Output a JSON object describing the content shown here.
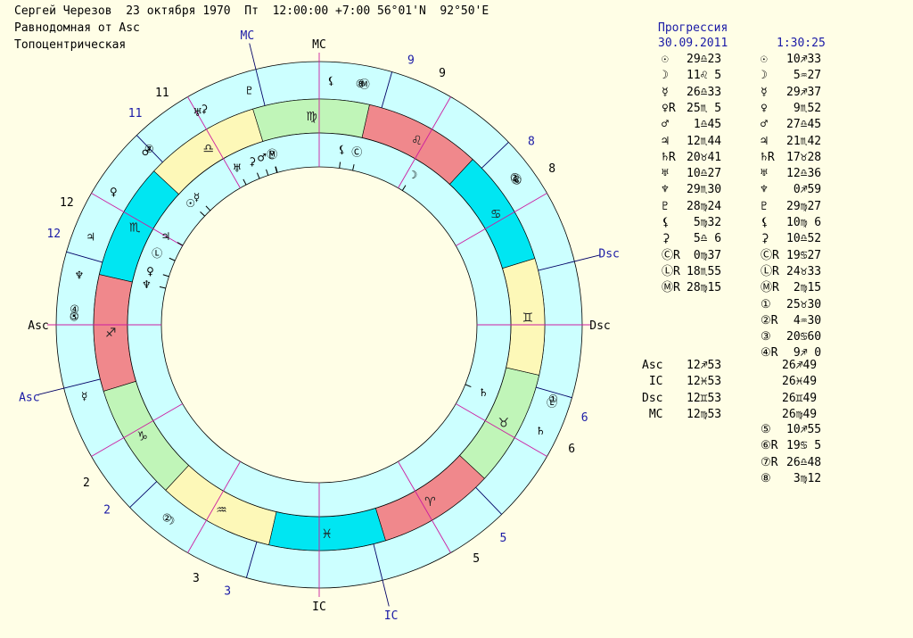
{
  "header": {
    "line1": "Сергей Черезов  23 октября 1970  Пт  12:00:00 +7:00 56°01'N  92°50'E",
    "line2": "Равнодомная от Asc",
    "line3": "Топоцентрическая"
  },
  "chart": {
    "outer_ring_color": "#ccffff",
    "zodiac_colors": {
      "fire": "#f0888c",
      "earth": "#c0f5b8",
      "air": "#fdf8b8",
      "water": "#00e6f2"
    },
    "signs": [
      "♈",
      "♉",
      "♊",
      "♋",
      "♌",
      "♍",
      "♎",
      "♏",
      "♐",
      "♑",
      "♒",
      "♓"
    ],
    "natal_house_labels": [
      "Asc",
      "2",
      "3",
      "IC",
      "5",
      "6",
      "Dsc",
      "8",
      "9",
      "MC",
      "11",
      "12"
    ],
    "progressed_house_labels": [
      "Asc",
      "2",
      "3",
      "IC",
      "5",
      "6",
      "Dsc",
      "8",
      "9",
      "MC",
      "11",
      "12"
    ],
    "natal_planets": [
      {
        "glyph": "☉",
        "lon": 209.38
      },
      {
        "glyph": "☽",
        "lon": 131.08
      },
      {
        "glyph": "☿",
        "lon": 206.55
      },
      {
        "glyph": "♀",
        "lon": 235.08
      },
      {
        "glyph": "♂",
        "lon": 181.75
      },
      {
        "glyph": "♃",
        "lon": 222.73
      },
      {
        "glyph": "♄",
        "lon": 50.68
      },
      {
        "glyph": "♅",
        "lon": 190.45
      },
      {
        "glyph": "♆",
        "lon": 239.5
      },
      {
        "glyph": "♇",
        "lon": 178.4
      },
      {
        "glyph": "⚸",
        "lon": 155.53
      },
      {
        "glyph": "⚳",
        "lon": 185.1
      },
      {
        "glyph": "Ⓒ",
        "lon": 150.62
      },
      {
        "glyph": "Ⓛ",
        "lon": 228.92
      },
      {
        "glyph": "Ⓜ",
        "lon": 178.25
      }
    ],
    "progressed_planets": [
      {
        "glyph": "☉",
        "lon": 250.55
      },
      {
        "glyph": "☽",
        "lon": 305.45
      },
      {
        "glyph": "☿",
        "lon": 269.62
      },
      {
        "glyph": "♀",
        "lon": 219.87
      },
      {
        "glyph": "♂",
        "lon": 207.75
      },
      {
        "glyph": "♃",
        "lon": 231.7
      },
      {
        "glyph": "♄",
        "lon": 47.47
      },
      {
        "glyph": "♅",
        "lon": 192.6
      },
      {
        "glyph": "♆",
        "lon": 240.98
      },
      {
        "glyph": "♇",
        "lon": 179.45
      },
      {
        "glyph": "⚸",
        "lon": 160.1
      },
      {
        "glyph": "⚳",
        "lon": 190.87
      },
      {
        "glyph": "Ⓒ",
        "lon": 109.45
      },
      {
        "glyph": "Ⓛ",
        "lon": 54.55
      },
      {
        "glyph": "Ⓜ",
        "lon": 152.25
      },
      {
        "glyph": "①",
        "lon": 55.5
      },
      {
        "glyph": "②",
        "lon": 304.5
      },
      {
        "glyph": "③",
        "lon": 110.0
      },
      {
        "glyph": "④",
        "lon": 249.0
      },
      {
        "glyph": "⑤",
        "lon": 250.92
      },
      {
        "glyph": "⑥",
        "lon": 109.08
      },
      {
        "glyph": "⑦",
        "lon": 206.8
      },
      {
        "glyph": "⑧",
        "lon": 153.2
      }
    ]
  },
  "progression": {
    "title": "Прогрессия",
    "date": "30.09.2011",
    "time": "1:30:25",
    "natal_rows": [
      {
        "g": "☉",
        "v": "29♎23"
      },
      {
        "g": "☽",
        "v": "11♌ 5"
      },
      {
        "g": "☿",
        "v": "26♎33"
      },
      {
        "g": "♀R",
        "v": "25♏ 5"
      },
      {
        "g": "♂",
        "v": " 1♎45"
      },
      {
        "g": "♃",
        "v": "12♏44"
      },
      {
        "g": "♄R",
        "v": "20♉41"
      },
      {
        "g": "♅",
        "v": "10♎27"
      },
      {
        "g": "♆",
        "v": "29♏30"
      },
      {
        "g": "♇",
        "v": "28♍24"
      },
      {
        "g": "⚸",
        "v": " 5♍32"
      },
      {
        "g": "⚳",
        "v": " 5♎ 6"
      },
      {
        "g": "ⒸR",
        "v": " 0♍37"
      },
      {
        "g": "ⓁR",
        "v": "18♏55"
      },
      {
        "g": "ⓂR",
        "v": "28♍15"
      }
    ],
    "prog_rows": [
      {
        "g": "☉",
        "v": "10♐33"
      },
      {
        "g": "☽",
        "v": " 5♒27"
      },
      {
        "g": "☿",
        "v": "29♐37"
      },
      {
        "g": "♀",
        "v": " 9♏52"
      },
      {
        "g": "♂",
        "v": "27♎45"
      },
      {
        "g": "♃",
        "v": "21♏42"
      },
      {
        "g": "♄R",
        "v": "17♉28"
      },
      {
        "g": "♅",
        "v": "12♎36"
      },
      {
        "g": "♆",
        "v": " 0♐59"
      },
      {
        "g": "♇",
        "v": "29♍27"
      },
      {
        "g": "⚸",
        "v": "10♍ 6"
      },
      {
        "g": "⚳",
        "v": "10♎52"
      },
      {
        "g": "ⒸR",
        "v": "19♋27"
      },
      {
        "g": "ⓁR",
        "v": "24♉33"
      },
      {
        "g": "ⓂR",
        "v": " 2♍15"
      },
      {
        "g": "①",
        "v": "25♉30"
      },
      {
        "g": "②R",
        "v": " 4♒30"
      },
      {
        "g": "③",
        "v": "20♋60"
      },
      {
        "g": "④R",
        "v": " 9♐ 0"
      }
    ],
    "angle_rows": [
      {
        "label": "Asc",
        "natal": "12♐53",
        "prog": "26♐49"
      },
      {
        "label": " IC",
        "natal": "12♓53",
        "prog": "26♓49"
      },
      {
        "label": "Dsc",
        "natal": "12♊53",
        "prog": "26♊49"
      },
      {
        "label": " MC",
        "natal": "12♍53",
        "prog": "26♍49"
      }
    ],
    "extra_rows": [
      {
        "g": "⑤",
        "v": "10♐55"
      },
      {
        "g": "⑥R",
        "v": "19♋ 5"
      },
      {
        "g": "⑦R",
        "v": "26♎48"
      },
      {
        "g": "⑧",
        "v": " 3♍12"
      }
    ]
  }
}
